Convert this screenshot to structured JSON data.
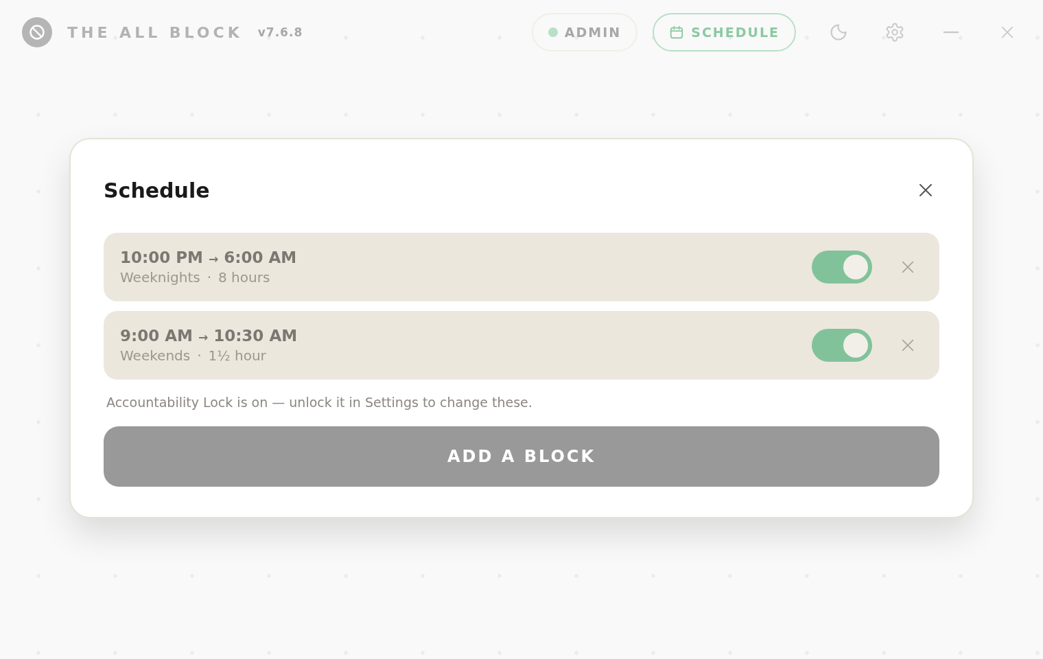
{
  "app": {
    "title": "THE ALL BLOCK",
    "version": "v7.6.8"
  },
  "header": {
    "admin": {
      "label": "ADMIN",
      "color": "#b9dfc7"
    },
    "schedule": {
      "label": "SCHEDULE",
      "selected": true
    }
  },
  "dialog": {
    "title": "Schedule",
    "blocks": [
      {
        "time_from": "10:00 PM",
        "arrow": "→",
        "time_to": "6:00 AM",
        "days": "Weeknights",
        "sep": "·",
        "duration": "8 hours",
        "on": true
      },
      {
        "time_from": "9:00 AM",
        "arrow": "→",
        "time_to": "10:30 AM",
        "days": "Weekends",
        "sep": "·",
        "duration": "1½ hour",
        "on": true
      }
    ],
    "note": "Accountability Lock is on — unlock it in Settings to change these.",
    "add_button": "ADD A BLOCK"
  }
}
